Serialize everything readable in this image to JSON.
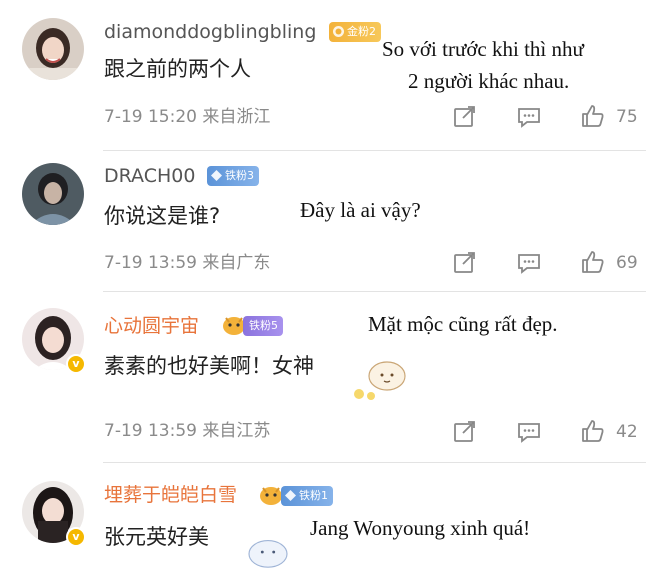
{
  "comments": [
    {
      "username": "diamonddogblingbling",
      "fan_badge": "金粉2",
      "text": "跟之前的两个人",
      "timestamp": "7-19 15:20 来自浙江",
      "likes": "75",
      "translation": [
        "So với trước khi thì như",
        "2 người khác nhau."
      ],
      "username_color": "#555555",
      "badge_color": "#f3b23a"
    },
    {
      "username": "DRACH00",
      "fan_badge": "铁粉3",
      "text": "你说这是谁?",
      "timestamp": "7-19 13:59 来自广东",
      "likes": "69",
      "translation": [
        "Đây là ai vậy?"
      ],
      "username_color": "#555555",
      "badge_color": "#5b93d8"
    },
    {
      "username": "心动圆宇宙",
      "fan_badge": "铁粉5",
      "text": "素素的也好美啊！女神",
      "timestamp": "7-19 13:59 来自江苏",
      "likes": "42",
      "translation": [
        "Mặt mộc cũng rất đẹp."
      ],
      "username_color": "#e8743b",
      "badge_color": "#8a72dd"
    },
    {
      "username": "埋葬于皑皑白雪",
      "fan_badge": "铁粉1",
      "text": "张元英好美",
      "translation": [
        "Jang Wonyoung xinh quá!"
      ],
      "username_color": "#e8743b",
      "badge_color": "#5b93d8"
    }
  ],
  "icons": {
    "share": "share-icon",
    "reply": "comment-icon",
    "like": "thumbs-up-icon",
    "verified": "verified-v-icon"
  }
}
